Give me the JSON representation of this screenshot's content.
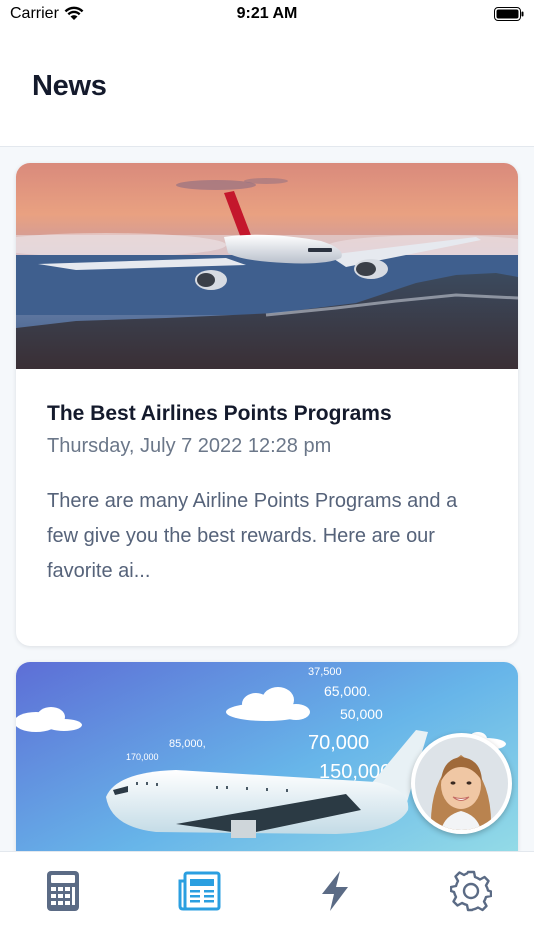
{
  "status_bar": {
    "carrier": "Carrier",
    "time": "9:21 AM"
  },
  "header": {
    "title": "News"
  },
  "articles": [
    {
      "title": "The Best Airlines Points Programs",
      "date": "Thursday, July 7 2022 12:28 pm",
      "excerpt": "There are many Airline Points Programs and a few give you the best rewards. Here are our favorite ai..."
    }
  ],
  "card2_image": {
    "numbers": [
      "37,500",
      "65,000.",
      "50,000",
      "85,000,",
      "170,000",
      "70,000",
      "150,000"
    ]
  },
  "tabs": [
    {
      "id": "calculator",
      "icon": "calculator-icon"
    },
    {
      "id": "news",
      "icon": "newspaper-icon",
      "active": true
    },
    {
      "id": "deals",
      "icon": "lightning-icon"
    },
    {
      "id": "settings",
      "icon": "gear-icon"
    }
  ],
  "colors": {
    "active_tab": "#2b9fe0",
    "inactive_tab": "#5b6b85",
    "title_text": "#141a2c",
    "date_text": "#6b7789",
    "body_text": "#56637a"
  }
}
